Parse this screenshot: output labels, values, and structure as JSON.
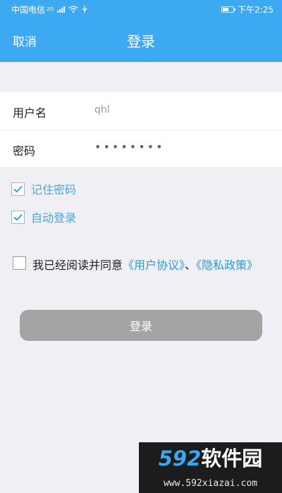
{
  "status_bar": {
    "carrier": "中国电信",
    "network": "2G",
    "time": "下午2:25",
    "battery_level": 0.6
  },
  "header": {
    "cancel_label": "取消",
    "title": "登录"
  },
  "form": {
    "username_label": "用户名",
    "username_value": "qhl",
    "password_label": "密码",
    "password_dots": "••••••••"
  },
  "options": {
    "remember_password_label": "记住密码",
    "remember_password_checked": true,
    "auto_login_label": "自动登录",
    "auto_login_checked": true
  },
  "agreement": {
    "checked": false,
    "prefix": "我已经阅读并同意",
    "user_agreement_link": "《用户协议》",
    "separator": "、",
    "privacy_policy_link": "《隐私政策》"
  },
  "login_button_label": "登录",
  "watermark": {
    "logo_number": "592",
    "logo_text": "软件园",
    "url": "www.592xiazai.com"
  },
  "colors": {
    "accent": "#3ea9f3",
    "link": "#2d9ad6",
    "button_disabled": "#a4a4a4"
  }
}
